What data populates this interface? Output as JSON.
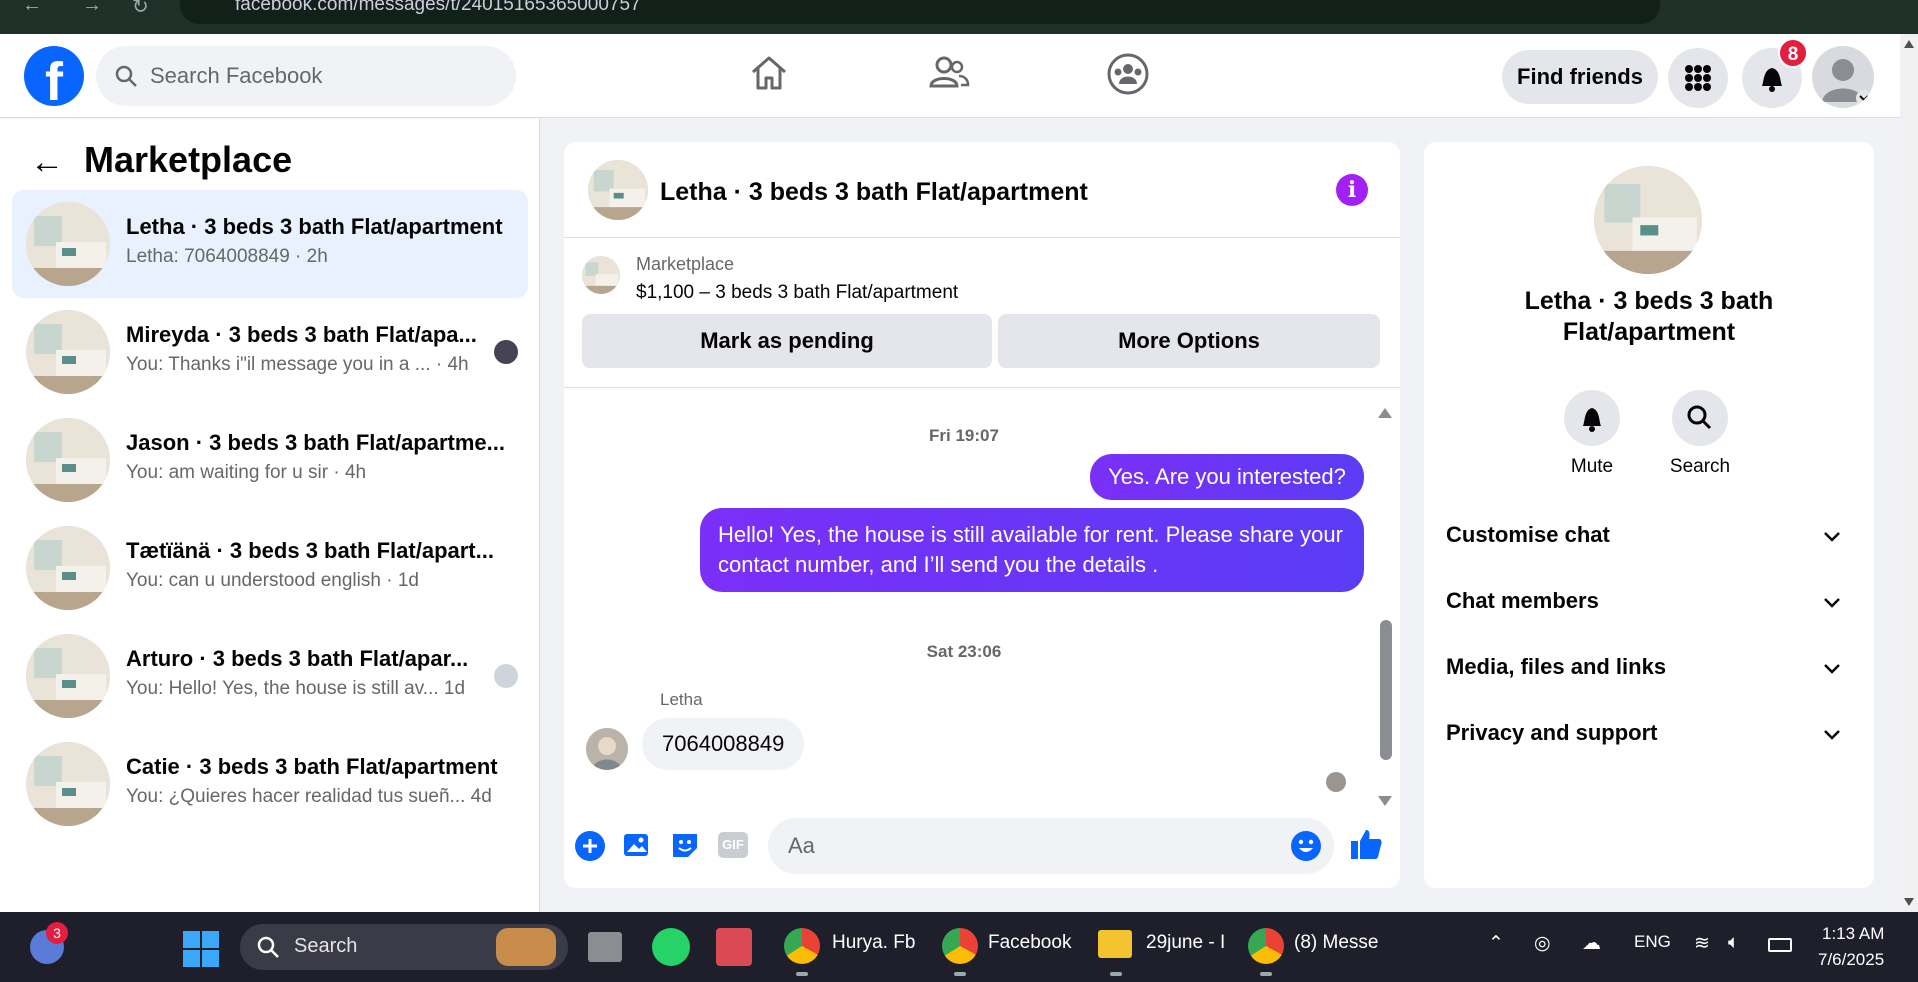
{
  "browser": {
    "url": "facebook.com/messages/t/24015165365000757"
  },
  "header": {
    "search_placeholder": "Search Facebook",
    "find_friends_label": "Find friends",
    "notification_count": "8",
    "icons": [
      "home-icon",
      "friends-icon",
      "groups-icon",
      "menu-grid-icon",
      "bell-icon"
    ]
  },
  "sidebar": {
    "title": "Marketplace",
    "conversations": [
      {
        "name": "Letha · 3 beds 3 bath Flat/apartment",
        "preview": "Letha: 7064008849 · 2h",
        "active": true
      },
      {
        "name": "Mireyda · 3 beds 3 bath Flat/apa...",
        "preview": "You: Thanks i\"il message you in a ...   · 4h"
      },
      {
        "name": "Jason · 3 beds 3 bath Flat/apartme...",
        "preview": "You: am waiting for u sir · 4h"
      },
      {
        "name": "Tætïänä · 3 beds 3 bath Flat/apart...",
        "preview": "You: can u understood english · 1d"
      },
      {
        "name": "Arturo · 3 beds 3 bath Flat/apar...",
        "preview": "You: Hello! Yes, the house is still av...    1d"
      },
      {
        "name": "Catie · 3 beds 3 bath Flat/apartment",
        "preview": "You: ¿Quieres hacer realidad tus sueñ...    4d"
      }
    ]
  },
  "chat": {
    "title": "Letha · 3 beds 3 bath Flat/apartment",
    "listing_source": "Marketplace",
    "listing_price": "$1,100 – 3 beds 3 bath Flat/apartment",
    "mark_pending_label": "Mark as pending",
    "more_options_label": "More Options",
    "timestamp_1": "Fri 19:07",
    "msg_out_1": "Yes. Are you interested?",
    "msg_out_2": "Hello! Yes, the house is still available for rent. Please share your contact number, and I’ll send you the details .",
    "timestamp_2": "Sat 23:06",
    "sender_name": "Letha",
    "msg_in_1": "7064008849",
    "composer_placeholder": "Aa"
  },
  "details": {
    "title": "Letha · 3 beds 3 bath Flat/apartment",
    "mute_label": "Mute",
    "search_label": "Search",
    "sections": [
      "Customise chat",
      "Chat members",
      "Media, files and links",
      "Privacy and support"
    ]
  },
  "taskbar": {
    "weather_badge": "3",
    "search_label": "Search",
    "apps": [
      "Hurya. Fb",
      "Facebook",
      "29june - I",
      "(8) Messe"
    ],
    "language": "ENG",
    "time": "1:13 AM",
    "date": "7/6/2025"
  },
  "colors": {
    "brand": "#0866ff",
    "accent_purple": "#a21ff5",
    "bubble": "#7b2ff7",
    "badge": "#e41e3f"
  }
}
